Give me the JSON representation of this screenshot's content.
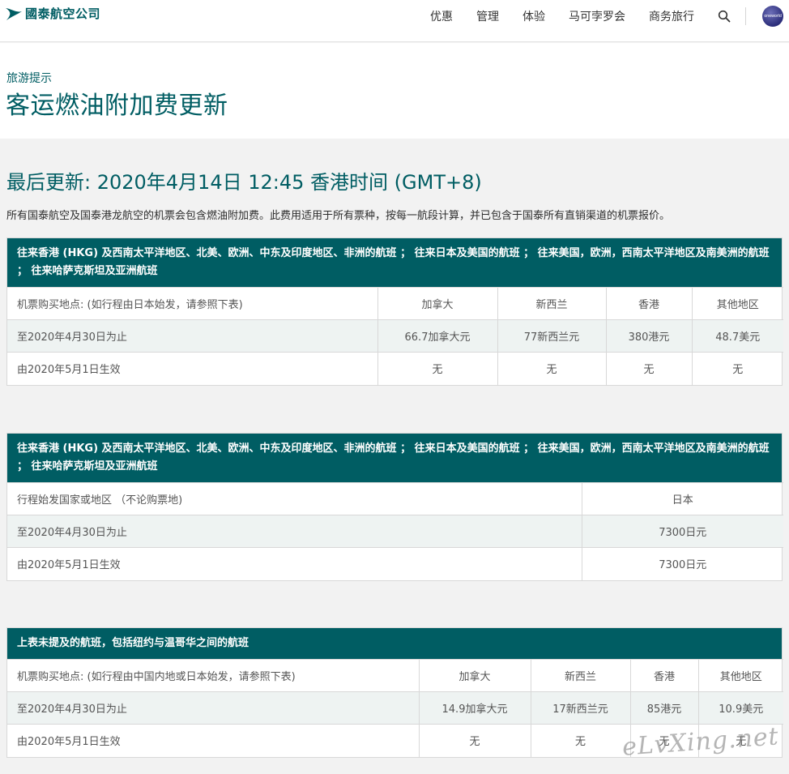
{
  "brand": {
    "name": "國泰航空公司",
    "color": "#005d63"
  },
  "nav": {
    "items": [
      "优惠",
      "管理",
      "体验",
      "马可孛罗会",
      "商务旅行"
    ],
    "search_icon": "search-icon",
    "alliance": "oneworld"
  },
  "hero": {
    "breadcrumb": "旅游提示",
    "title": "客运燃油附加费更新"
  },
  "main": {
    "updated": "最后更新: 2020年4月14日 12:45 香港时间 (GMT+8)",
    "intro": "所有国泰航空及国泰港龙航空的机票会包含燃油附加费。此费用适用于所有票种，按每一航段计算，并已包含于国泰所有直销渠道的机票报价。"
  },
  "tables": [
    {
      "heading": "往来香港 (HKG) 及西南太平洋地区、北美、欧洲、中东及印度地区、非洲的航班 ； 往来日本及美国的航班 ； 往来美国，欧洲，西南太平洋地区及南美洲的航班 ； 往来哈萨克斯坦及亚洲航班",
      "header": [
        "机票购买地点: (如行程由日本始发，请参照下表)",
        "加拿大",
        "新西兰",
        "香港",
        "其他地区"
      ],
      "rows": [
        [
          "至2020年4月30日为止",
          "66.7加拿大元",
          "77新西兰元",
          "380港元",
          "48.7美元"
        ],
        [
          "由2020年5月1日生效",
          "无",
          "无",
          "无",
          "无"
        ]
      ]
    },
    {
      "heading": "往来香港 (HKG) 及西南太平洋地区、北美、欧洲、中东及印度地区、非洲的航班 ； 往来日本及美国的航班 ； 往来美国，欧洲，西南太平洋地区及南美洲的航班 ； 往来哈萨克斯坦及亚洲航班",
      "header": [
        "行程始发国家或地区 （不论购票地)",
        "日本"
      ],
      "rows": [
        [
          "至2020年4月30日为止",
          "7300日元"
        ],
        [
          "由2020年5月1日生效",
          "7300日元"
        ]
      ]
    },
    {
      "heading": "上表未提及的航班，包括纽约与温哥华之间的航班",
      "header": [
        "机票购买地点: (如行程由中国内地或日本始发，请参照下表)",
        "加拿大",
        "新西兰",
        "香港",
        "其他地区"
      ],
      "rows": [
        [
          "至2020年4月30日为止",
          "14.9加拿大元",
          "17新西兰元",
          "85港元",
          "10.9美元"
        ],
        [
          "由2020年5月1日生效",
          "无",
          "无",
          "无",
          "无"
        ]
      ]
    }
  ],
  "watermark": "eLvXing.net"
}
